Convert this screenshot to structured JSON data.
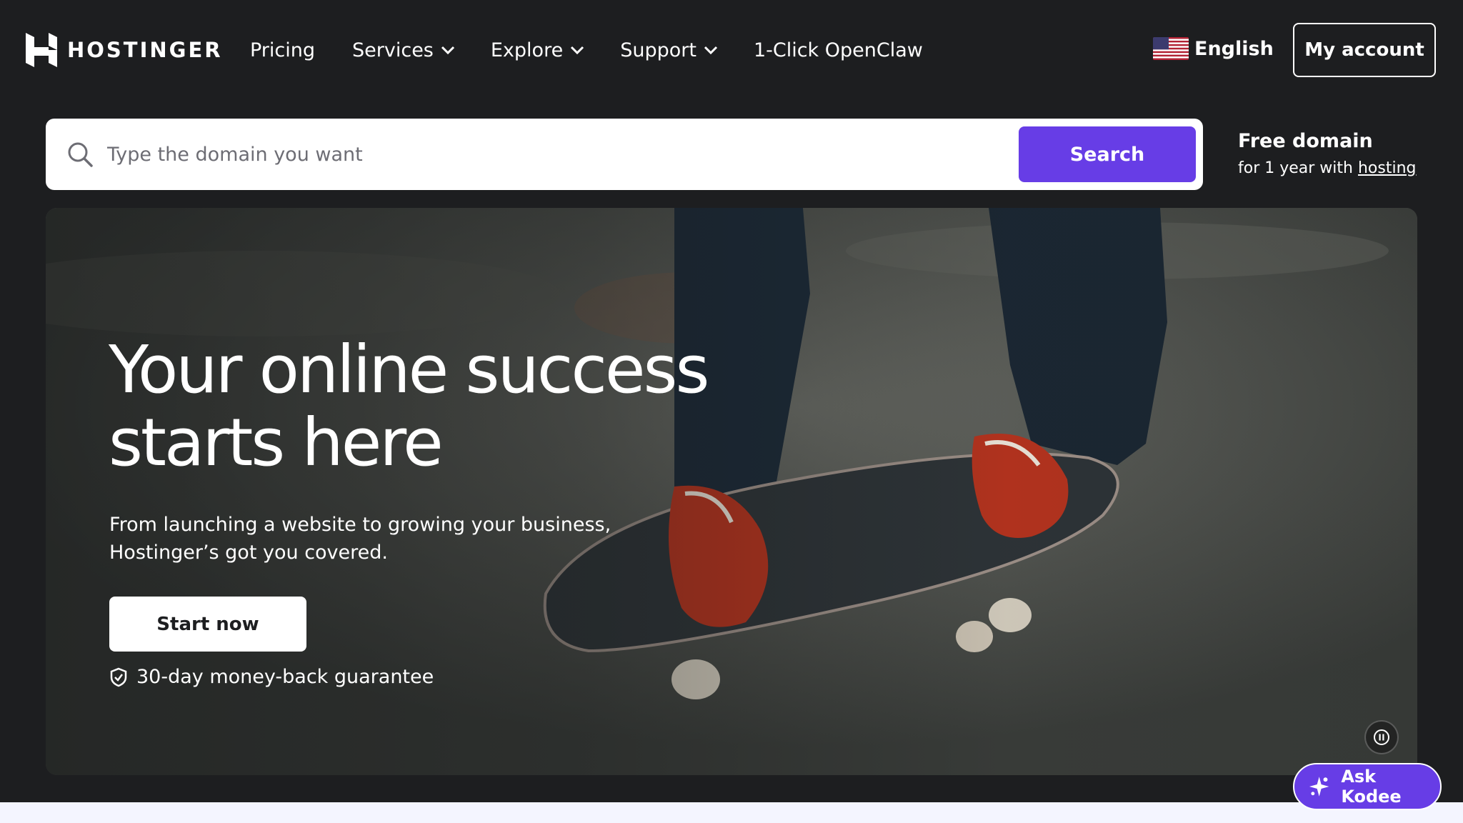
{
  "brand": {
    "name": "HOSTINGER"
  },
  "nav": {
    "items": [
      {
        "label": "Pricing",
        "dropdown": false
      },
      {
        "label": "Services",
        "dropdown": true
      },
      {
        "label": "Explore",
        "dropdown": true
      },
      {
        "label": "Support",
        "dropdown": true
      },
      {
        "label": "1-Click OpenClaw",
        "dropdown": false
      }
    ],
    "language": {
      "label": "English",
      "flag_icon": "us-flag-icon"
    },
    "account_label": "My account"
  },
  "search": {
    "placeholder": "Type the domain you want",
    "value": "",
    "button_label": "Search"
  },
  "promo": {
    "title": "Free domain",
    "subtitle_prefix": "for 1 year with ",
    "subtitle_link": "hosting"
  },
  "hero": {
    "title_line1": "Your online success",
    "title_line2": "starts here",
    "description": "From launching a website to growing your business, Hostinger’s got you covered.",
    "cta_label": "Start now",
    "guarantee": "30-day money-back guarantee"
  },
  "assistant": {
    "label": "Ask Kodee"
  },
  "colors": {
    "header_bg": "#1d1e20",
    "accent": "#673de6",
    "text": "#ffffff"
  }
}
